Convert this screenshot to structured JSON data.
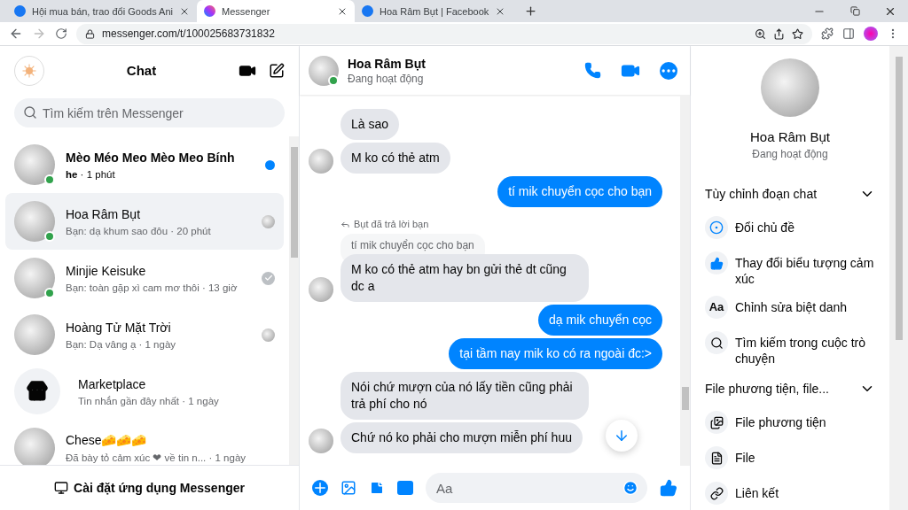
{
  "browser": {
    "tabs": [
      {
        "title": "Hội mua bán, trao đổi Goods Ani",
        "kind": "facebook",
        "selected": false
      },
      {
        "title": "Messenger",
        "kind": "messenger",
        "selected": true
      },
      {
        "title": "Hoa Râm Bụt | Facebook",
        "kind": "facebook",
        "selected": false
      }
    ],
    "url": "messenger.com/t/100025683731832"
  },
  "sidebar": {
    "title": "Chat",
    "search": {
      "placeholder": "Tìm kiếm trên Messenger"
    },
    "chats": [
      {
        "kind": "person",
        "name": "Mèo Méo Meo Mèo Meo Bính",
        "preview": "**he** · 1 phút",
        "unread": true,
        "online": true,
        "seen": false,
        "delivered": false,
        "selected": false
      },
      {
        "kind": "person",
        "name": "Hoa Râm Bụt",
        "preview": "Bạn: dạ khum sao đôu · 20 phút",
        "unread": false,
        "online": true,
        "seen": true,
        "delivered": false,
        "selected": true
      },
      {
        "kind": "person",
        "name": "Minjie Keisuke",
        "preview": "Bạn: toàn gặp xì cam mơ thôi · 13 giờ",
        "unread": false,
        "online": true,
        "seen": false,
        "delivered": true,
        "selected": false
      },
      {
        "kind": "person",
        "name": "Hoàng Tử Mặt Trời",
        "preview": "Bạn: Dạ vâng ạ · 1 ngày",
        "unread": false,
        "online": false,
        "seen": true,
        "delivered": false,
        "selected": false
      },
      {
        "kind": "marketplace",
        "name": "Marketplace",
        "preview": "Tin nhắn gần đây nhất · 1 ngày",
        "unread": false,
        "online": false,
        "seen": false,
        "delivered": false,
        "selected": false
      },
      {
        "kind": "person",
        "name": "Chese🧀🧀🧀",
        "preview": "Đã bày tỏ cảm xúc ❤ về tin n...  · 1 ngày",
        "unread": false,
        "online": false,
        "seen": false,
        "delivered": false,
        "selected": false
      }
    ],
    "install": "Cài đặt ứng dụng Messenger"
  },
  "conversation": {
    "name": "Hoa Râm Bụt",
    "status": "Đang hoạt động",
    "online": true,
    "messages": [
      {
        "kind": "incoming",
        "text": "Là sao",
        "avatar": false
      },
      {
        "kind": "incoming",
        "text": "M ko có thẻ atm",
        "avatar": true
      },
      {
        "kind": "outgoing",
        "text": "tí mik chuyển cọc cho bạn"
      },
      {
        "kind": "reply",
        "label": "Bụt đã trả lời bạn",
        "quote": "tí mik chuyển cọc cho bạn"
      },
      {
        "kind": "incoming",
        "text": "M ko có thẻ atm hay bn gửi thẻ dt cũng dc a",
        "avatar": true
      },
      {
        "kind": "outgoing",
        "text": "dạ mik chuyển cọc"
      },
      {
        "kind": "outgoing",
        "text": "tại tầm nay mik ko có ra ngoài đc:>"
      },
      {
        "kind": "incoming",
        "text": "Nói chứ mượn của nó lấy tiền cũng phải trả phí cho nó",
        "avatar": false
      },
      {
        "kind": "incoming",
        "text": "Chứ nó ko phải cho mượn miễn phí huu",
        "avatar": true
      }
    ],
    "composer": {
      "placeholder": "Aa"
    }
  },
  "info": {
    "name": "Hoa Râm Bụt",
    "status": "Đang hoạt động",
    "sections": [
      {
        "title": "Tùy chỉnh đoạn chat",
        "items": [
          {
            "kind": "icon",
            "label": "Đổi chủ đề"
          },
          {
            "kind": "icon",
            "label": "Thay đổi biểu tượng cảm xúc"
          },
          {
            "kind": "glyph",
            "glyph": "Aa",
            "label": "Chỉnh sửa biệt danh"
          },
          {
            "kind": "icon",
            "label": "Tìm kiếm trong cuộc trò chuyện"
          }
        ]
      },
      {
        "title": "File phương tiện, file...",
        "items": [
          {
            "kind": "icon",
            "label": "File phương tiện"
          },
          {
            "kind": "icon",
            "label": "File"
          },
          {
            "kind": "icon",
            "label": "Liên kết"
          }
        ]
      }
    ]
  }
}
